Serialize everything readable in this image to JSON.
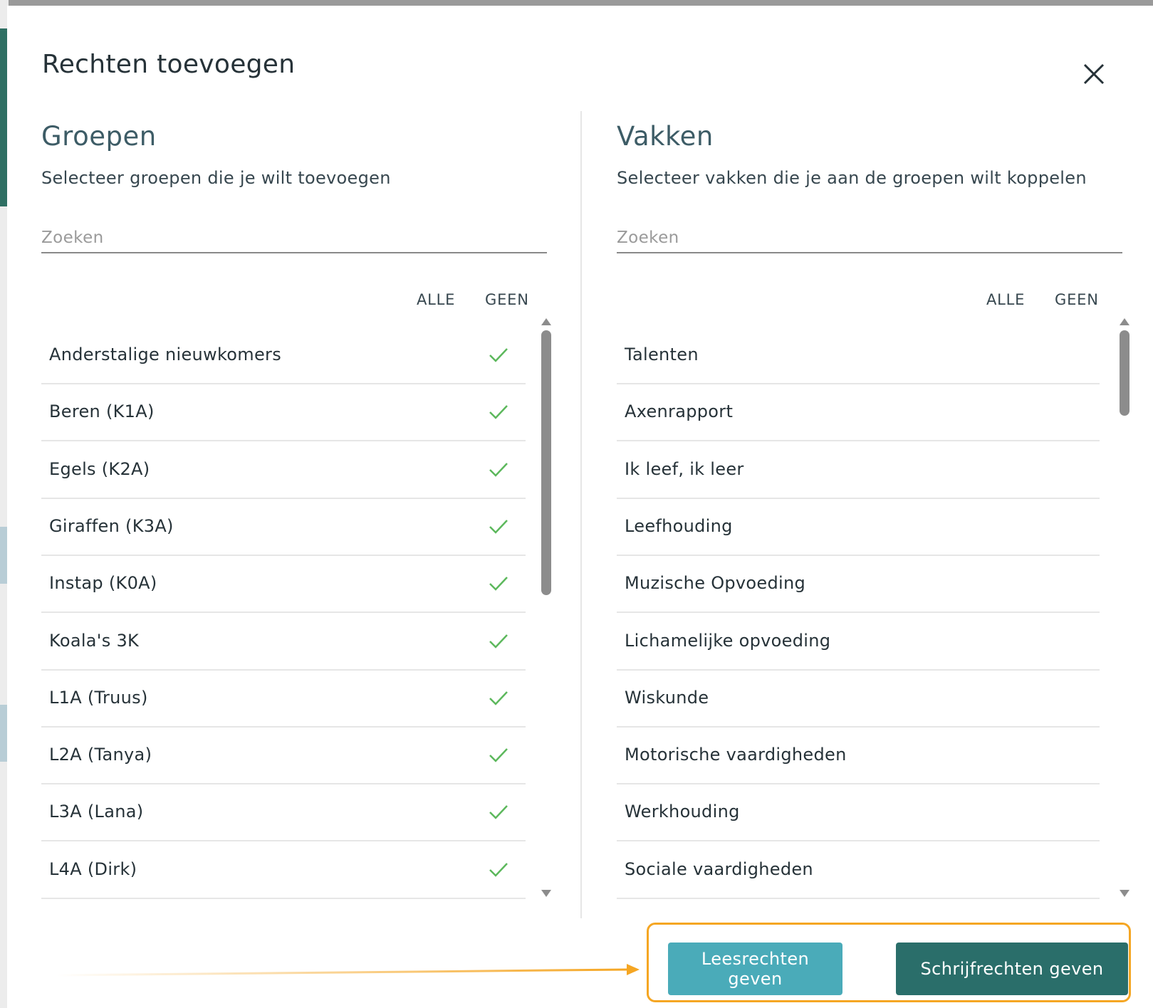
{
  "modal": {
    "title": "Rechten toevoegen",
    "close_icon": "close-icon"
  },
  "groups": {
    "title": "Groepen",
    "subtitle": "Selecteer groepen die je wilt toevoegen",
    "search_placeholder": "Zoeken",
    "select_all": "ALLE",
    "select_none": "GEEN",
    "items": [
      {
        "label": "Anderstalige nieuwkomers",
        "checked": true
      },
      {
        "label": "Beren (K1A)",
        "checked": true
      },
      {
        "label": "Egels (K2A)",
        "checked": true
      },
      {
        "label": "Giraffen (K3A)",
        "checked": true
      },
      {
        "label": "Instap (K0A)",
        "checked": true
      },
      {
        "label": "Koala's 3K",
        "checked": true
      },
      {
        "label": "L1A (Truus)",
        "checked": true
      },
      {
        "label": "L2A (Tanya)",
        "checked": true
      },
      {
        "label": "L3A (Lana)",
        "checked": true
      },
      {
        "label": "L4A (Dirk)",
        "checked": true
      }
    ]
  },
  "subjects": {
    "title": "Vakken",
    "subtitle": "Selecteer vakken die je aan de groepen wilt koppelen",
    "search_placeholder": "Zoeken",
    "select_all": "ALLE",
    "select_none": "GEEN",
    "items": [
      {
        "label": "Talenten",
        "checked": false
      },
      {
        "label": "Axenrapport",
        "checked": false
      },
      {
        "label": "Ik leef, ik leer",
        "checked": false
      },
      {
        "label": "Leefhouding",
        "checked": false
      },
      {
        "label": "Muzische Opvoeding",
        "checked": false
      },
      {
        "label": "Lichamelijke opvoeding",
        "checked": false
      },
      {
        "label": "Wiskunde",
        "checked": false
      },
      {
        "label": "Motorische vaardigheden",
        "checked": false
      },
      {
        "label": "Werkhouding",
        "checked": false
      },
      {
        "label": "Sociale vaardigheden",
        "checked": false
      }
    ]
  },
  "actions": {
    "read_label": "Leesrechten geven",
    "write_label": "Schrijfrechten geven"
  },
  "colors": {
    "accent_check": "#5cb85c",
    "read_button": "#4aabb9",
    "write_button": "#2a6e6a",
    "highlight": "#f5a623"
  }
}
